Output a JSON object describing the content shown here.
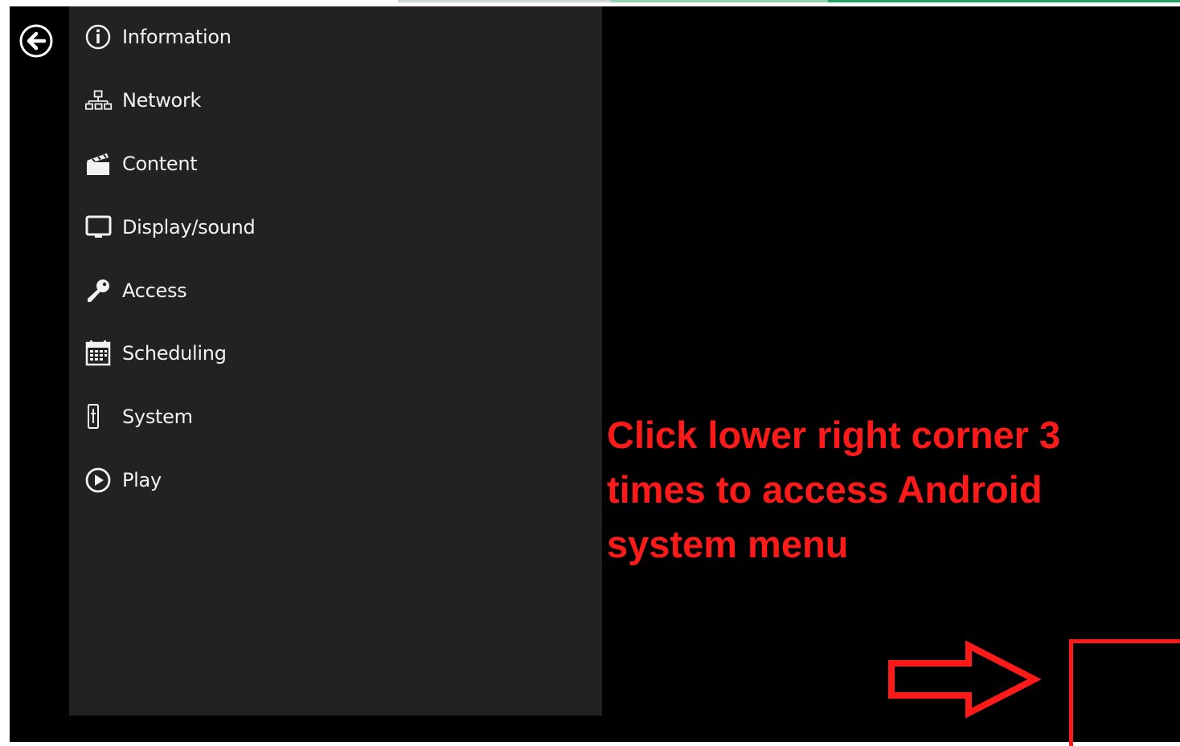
{
  "menu": {
    "items": [
      {
        "label": "Information",
        "icon": "info-icon"
      },
      {
        "label": "Network",
        "icon": "network-icon"
      },
      {
        "label": "Content",
        "icon": "clapperboard-icon"
      },
      {
        "label": "Display/sound",
        "icon": "monitor-icon"
      },
      {
        "label": "Access",
        "icon": "key-icon"
      },
      {
        "label": "Scheduling",
        "icon": "calendar-icon"
      },
      {
        "label": "System",
        "icon": "system-icon"
      },
      {
        "label": "Play",
        "icon": "play-icon"
      }
    ]
  },
  "annotation": {
    "lines": [
      "Click lower right corner 3",
      "times to access Android",
      "system menu"
    ]
  },
  "colors": {
    "background": "#000000",
    "panel": "#222222",
    "menu_text": "#f2f2f2",
    "annotation": "#ff1a1a"
  }
}
